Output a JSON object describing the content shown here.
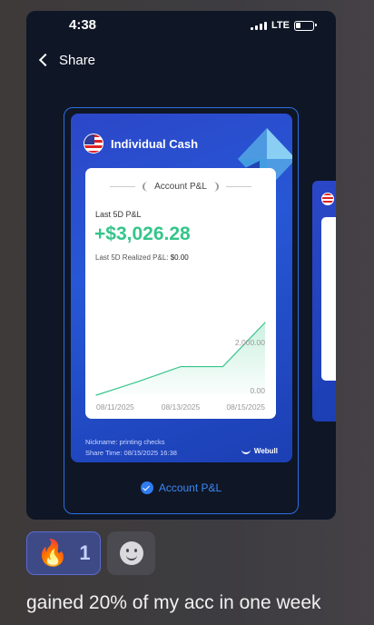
{
  "status_bar": {
    "time": "4:38",
    "network": "LTE"
  },
  "header": {
    "back_icon": "chevron-left-icon",
    "title": "Share"
  },
  "share_card": {
    "account_title": "Individual Cash",
    "flag_icon": "us-flag-icon",
    "badge_label": "Account P&L",
    "pnl_label": "Last 5D P&L",
    "pnl_value": "+$3,026.28",
    "realized_label": "Last 5D Realized P&L:",
    "realized_value": "$0.00",
    "nickname": "Nickname: printing checks",
    "share_time": "Share Time: 08/15/2025 16:38",
    "brand": "Webull",
    "accent_color": "#34c58a"
  },
  "chart_data": {
    "type": "area",
    "x_tick_labels": [
      "08/11/2025",
      "08/13/2025",
      "08/15/2025"
    ],
    "y_tick_labels": [
      "2,000.00",
      "0.00"
    ],
    "x": [
      "08/11/2025",
      "08/12/2025",
      "08/13/2025",
      "08/14/2025",
      "08/15/2025"
    ],
    "values": [
      0,
      570,
      1190,
      1190,
      3026.28
    ],
    "ylim": [
      0,
      3026.28
    ],
    "color": "#34c58a"
  },
  "selection": {
    "label": "Account P&L",
    "check_icon": "check-circle-icon"
  },
  "reactions": {
    "fire_emoji": "🔥",
    "fire_count": "1",
    "add_icon": "add-reaction-icon"
  },
  "message": {
    "text": "gained 20% of my acc in one week"
  }
}
